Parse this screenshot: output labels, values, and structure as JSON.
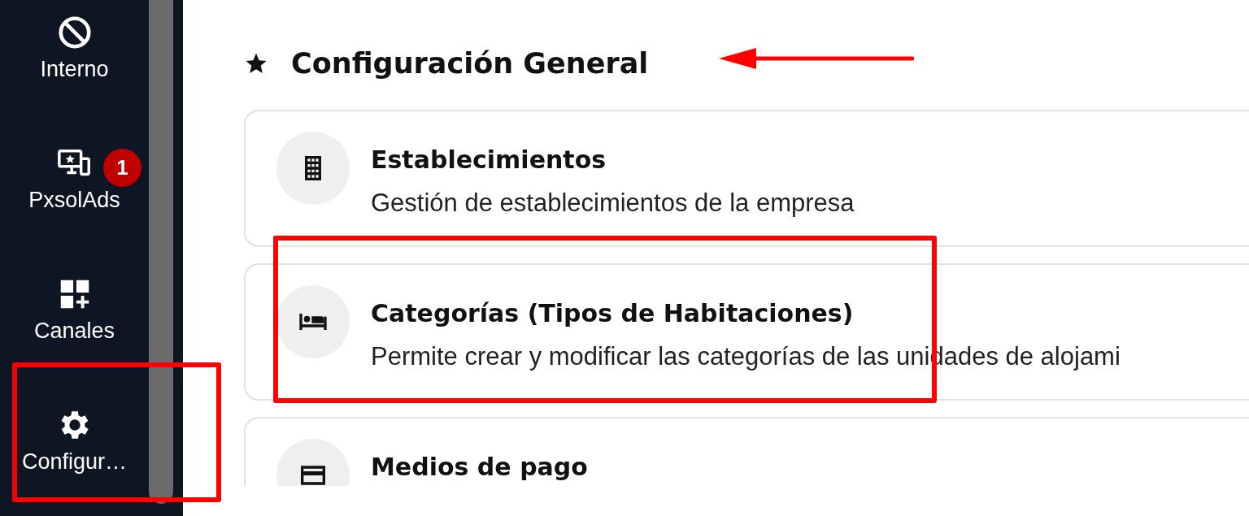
{
  "sidebar": {
    "items": [
      {
        "label": "Interno"
      },
      {
        "label": "PxsolAds",
        "badge": "1"
      },
      {
        "label": "Canales"
      },
      {
        "label": "Configur…"
      }
    ]
  },
  "page": {
    "title": "Configuración General"
  },
  "cards": [
    {
      "title": "Establecimientos",
      "description": "Gestión de establecimientos de la empresa"
    },
    {
      "title": "Categorías (Tipos de Habitaciones)",
      "description": "Permite crear y modificar las categorías de las unidades de alojami"
    },
    {
      "title": "Medios de pago"
    }
  ],
  "annotations": [
    {
      "kind": "arrow"
    },
    {
      "kind": "box"
    },
    {
      "kind": "box"
    }
  ]
}
